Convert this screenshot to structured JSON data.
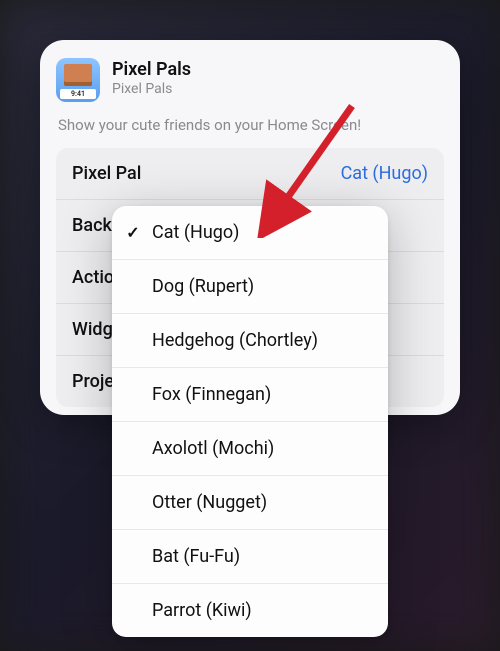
{
  "header": {
    "title": "Pixel Pals",
    "subtitle": "Pixel Pals"
  },
  "description": "Show your cute friends on your Home Screen!",
  "settings": {
    "rows": [
      {
        "label": "Pixel Pal",
        "value": "Cat (Hugo)"
      },
      {
        "label": "Backg",
        "value": ""
      },
      {
        "label": "Action",
        "value": ""
      },
      {
        "label": "Widge",
        "value": ""
      },
      {
        "label": "Projec",
        "value": ""
      }
    ]
  },
  "dropdown": {
    "items": [
      {
        "label": "Cat (Hugo)",
        "selected": true
      },
      {
        "label": "Dog (Rupert)",
        "selected": false
      },
      {
        "label": "Hedgehog (Chortley)",
        "selected": false
      },
      {
        "label": "Fox (Finnegan)",
        "selected": false
      },
      {
        "label": "Axolotl (Mochi)",
        "selected": false
      },
      {
        "label": "Otter (Nugget)",
        "selected": false
      },
      {
        "label": "Bat (Fu-Fu)",
        "selected": false
      },
      {
        "label": "Parrot (Kiwi)",
        "selected": false
      }
    ]
  },
  "checkmark": "✓"
}
